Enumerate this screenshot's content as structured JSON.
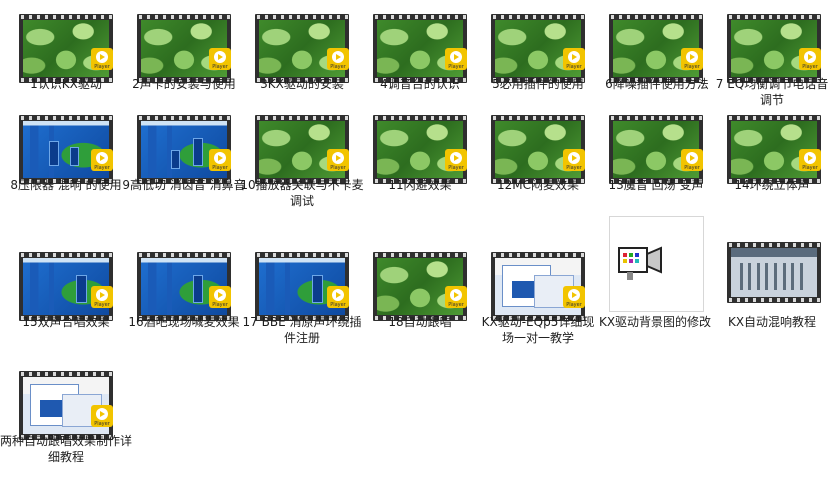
{
  "files": [
    {
      "label": "1认识KX驱动",
      "thumb": "leaf"
    },
    {
      "label": "2声卡的安装与使用",
      "thumb": "leaf"
    },
    {
      "label": "3KX驱动的安装",
      "thumb": "leaf"
    },
    {
      "label": "4调音台的认识",
      "thumb": "leaf"
    },
    {
      "label": "5必用插件的使用",
      "thumb": "leaf"
    },
    {
      "label": "6降噪插件使用方法",
      "thumb": "leaf"
    },
    {
      "label": "7 EQ均衡调节电话音调节",
      "thumb": "leaf"
    },
    {
      "label": "8压限器 混响 的使用",
      "thumb": "blue"
    },
    {
      "label": "9高低切 消齿音 消鼻音",
      "thumb": "blue"
    },
    {
      "label": "10播放器关联与不卡麦调试",
      "thumb": "leaf"
    },
    {
      "label": "11闪避效果",
      "thumb": "leaf"
    },
    {
      "label": "12MC闷麦效果",
      "thumb": "leaf"
    },
    {
      "label": "13魔音 回荡 变声",
      "thumb": "leaf"
    },
    {
      "label": "14环绕立体声",
      "thumb": "leaf"
    },
    {
      "label": "15双声合唱效果",
      "thumb": "blue"
    },
    {
      "label": "16酒吧现场喊麦效果",
      "thumb": "blue"
    },
    {
      "label": "17 BBE 消原声环绕插件注册",
      "thumb": "blue"
    },
    {
      "label": "18自动跟唱",
      "thumb": "leaf"
    },
    {
      "label": "KX驱动-EQp5详细现场一对一教学",
      "thumb": "screen"
    },
    {
      "label": "KX驱动背景图的修改",
      "thumb": "camera"
    },
    {
      "label": "KX自动混响教程",
      "thumb": "mixer"
    },
    {
      "label": "两种自动跟唱效果制作详细教程",
      "thumb": "screen"
    }
  ],
  "badge_text": "Player",
  "icons": {
    "video_badge": "player-badge-icon",
    "camera": "video-camera-icon"
  }
}
